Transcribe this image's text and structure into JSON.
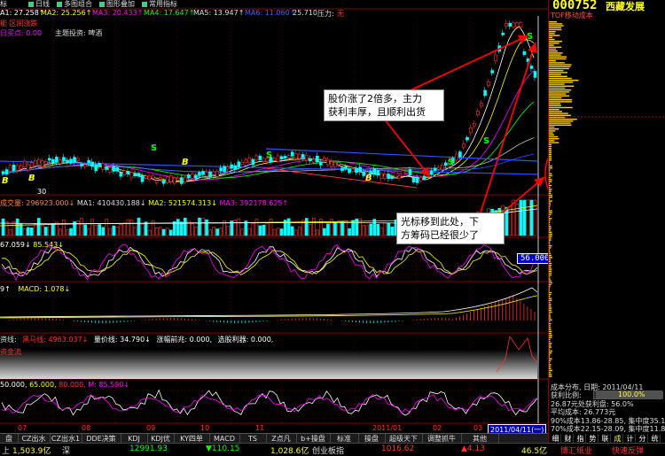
{
  "toolbar": {
    "items": [
      "日线",
      "多图组合",
      "图形叠加",
      "常用指标"
    ],
    "prefix": "标"
  },
  "ma": {
    "ma1": "A1: 27.258↑",
    "ma2": "MA2: 25.256↑",
    "ma3": "MA3: 20.433↑",
    "ma4": "MA4: 17.647↑",
    "ma5": "MA5: 13.947↑",
    "ma6": "MA6: 11.060↑",
    "last": "25.710",
    "pressure": "压力:",
    "pressure_val": "无",
    "line2_a": "能 区间涨跌",
    "line2_b": "日买点: 0.00",
    "theme": "主题投资: 啤酒"
  },
  "volume": {
    "label": "成交量: 296923.000↓",
    "ma1": "MA1: 410430.188↓",
    "ma2": "MA2: 521574.313↓",
    "ma3": "MA3: 392178.625↑"
  },
  "kdj": {
    "k": "67.059↓",
    "d": "85.543↓",
    "readout": "56.000"
  },
  "macd": {
    "dif": "9↑",
    "macd": "MACD: 1.078↓"
  },
  "ind4": {
    "a": "资线:",
    "b": "黑马线:",
    "b_val": "4963.037↓",
    "c": "量价线:",
    "c_val": "34.790↓",
    "d": "涨幅前兆: 0.000,",
    "e": "选股利器: 0.000,",
    "f": "资金流"
  },
  "ind5": {
    "a": "50.000,",
    "b": "65.000,",
    "c": "80.000,",
    "d": "M: 85.590↓"
  },
  "dates": [
    "07",
    "08",
    "09",
    "10",
    "11",
    "2011/01",
    "02",
    "03",
    "2011/04/11(一)"
  ],
  "callouts": {
    "top": [
      "股价涨了2倍多，主力",
      "获利丰厚，且顺利出货"
    ],
    "bottom": [
      "光标移到此处，下",
      "方筹码已经很少了"
    ]
  },
  "right": {
    "code": "000752",
    "name": "西藏发展",
    "tof": "TOF移动成本",
    "info": [
      "成本分布, 日期: 2011/04/11",
      "获利比例:",
      "26.87元处获利盘: 56.0%",
      "平均成本: 26.773元",
      "90%成本13.86-28.85, 集中度35.1",
      "70%成本22.15-28.09, 集中度11.8"
    ],
    "profit_pct": "100.0%",
    "tabs": [
      "细",
      "财",
      "指",
      "势",
      "联",
      "成",
      "计",
      "分",
      "统"
    ]
  },
  "tabbar": [
    "盘",
    "CZ出水",
    "CZ出水1",
    "DDE决策",
    "KDJ",
    "KDJ优",
    "KY四单",
    "MACD",
    "TS",
    "Z点凡",
    "b+操盘",
    "标准",
    "操盘",
    "超级天下",
    "调整抓牛",
    "其他"
  ],
  "status": {
    "a_label": "上",
    "a_val": "1,503.9亿",
    "b_label": "深",
    "b_val": "12991.93",
    "c_val": "▼110.15",
    "d_val": "1,028.6亿",
    "e_label": "创业板指",
    "f_val": "1016.62",
    "g_val": "▲4.13",
    "h_val": "46.5亿",
    "i": "博汇纸业 ",
    "j": "快速反弹"
  },
  "colors": {
    "up": "#ff3232",
    "down": "#00ffff",
    "ma_yellow": "#ffff00",
    "ma_white": "#ffffff",
    "ma_green": "#00ff00",
    "ma_purple": "#ff00ff",
    "accent": "#ffff33"
  }
}
